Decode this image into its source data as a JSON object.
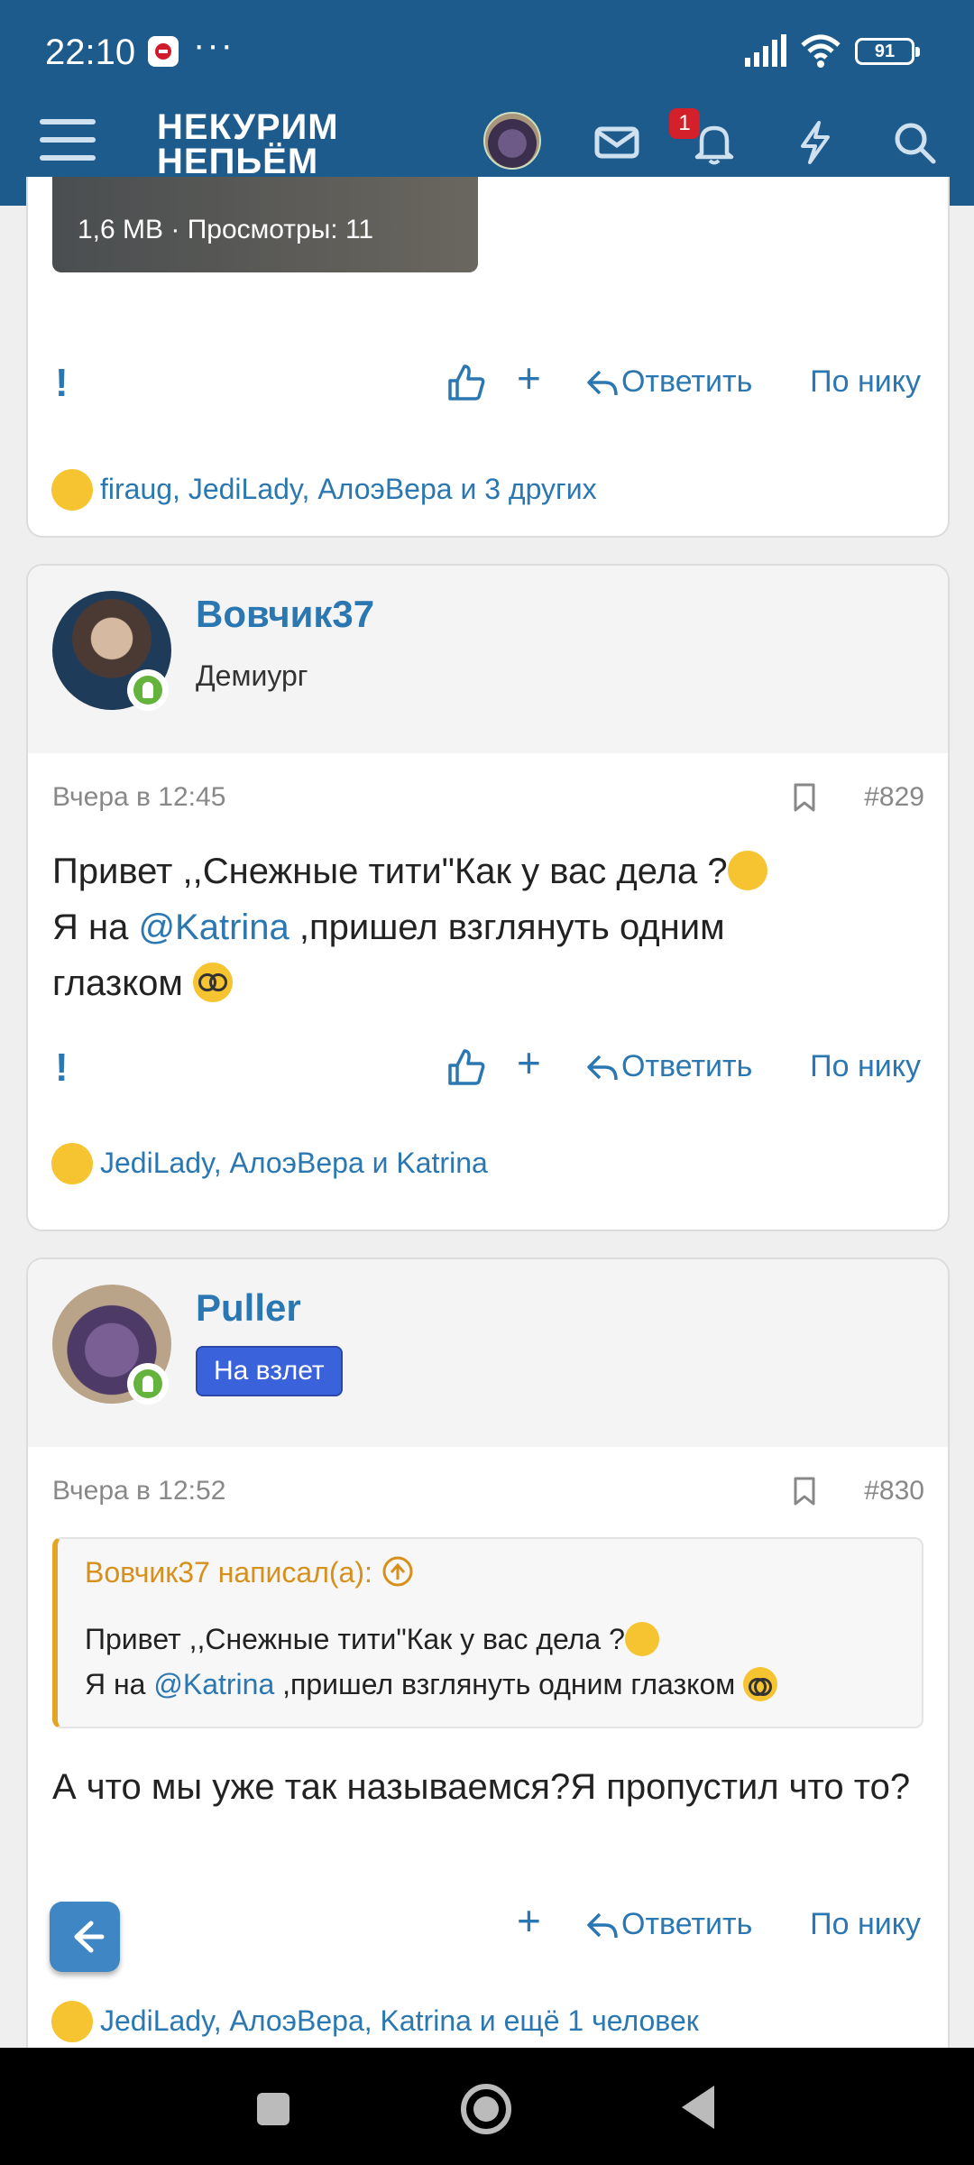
{
  "status_bar": {
    "time": "22:10",
    "more": "···",
    "battery": "91"
  },
  "header": {
    "logo_line1": "НЕКУРИМ",
    "logo_line2": "НЕПЬЁМ",
    "notifications_count": "1",
    "icons": [
      "menu-icon",
      "avatar",
      "mail-icon",
      "bell-icon",
      "lightning-icon",
      "search-icon"
    ]
  },
  "post_top": {
    "media_caption": "1,6 MB · Просмотры: 11",
    "actions": {
      "flag": "!",
      "plus": "+",
      "reply": "Ответить",
      "by_nick": "По нику"
    },
    "reactions": "firaug, JediLady, АлоэВера и 3 других"
  },
  "post_829": {
    "username": "Вовчик37",
    "user_title": "Демиург",
    "date": "Вчера в 12:45",
    "number": "#829",
    "text_line1": "Привет ,,Снежные тити\"Как у вас дела ?",
    "text_line2_pre": "Я на ",
    "mention": "@Katrina",
    "text_line2_post": " ,пришел взглянуть одним",
    "text_line3": "глазком ",
    "actions": {
      "flag": "!",
      "plus": "+",
      "reply": "Ответить",
      "by_nick": "По нику"
    },
    "reactions": "JediLady, АлоэВера и Katrina"
  },
  "post_830": {
    "username": "Puller",
    "user_banner": "На взлет",
    "date": "Вчера в 12:52",
    "number": "#830",
    "quote": {
      "author": "Вовчик37 написал(а):",
      "line1": "Привет ,,Снежные тити\"Как у вас дела ?",
      "line2_pre": "Я на ",
      "mention": "@Katrina",
      "line2_post": " ,пришел взглянуть одним глазком "
    },
    "text": "А что мы уже так называемся?Я пропустил что то?",
    "actions": {
      "plus": "+",
      "reply": "Ответить",
      "by_nick": "По нику"
    },
    "reactions": "JediLady, АлоэВера, Katrina и ещё 1 человек"
  },
  "colors": {
    "header_bg": "#1e5b8d",
    "link": "#2a77b1",
    "quote_accent": "#e4a526",
    "banner": "#3a63db",
    "online": "#64b33c"
  }
}
